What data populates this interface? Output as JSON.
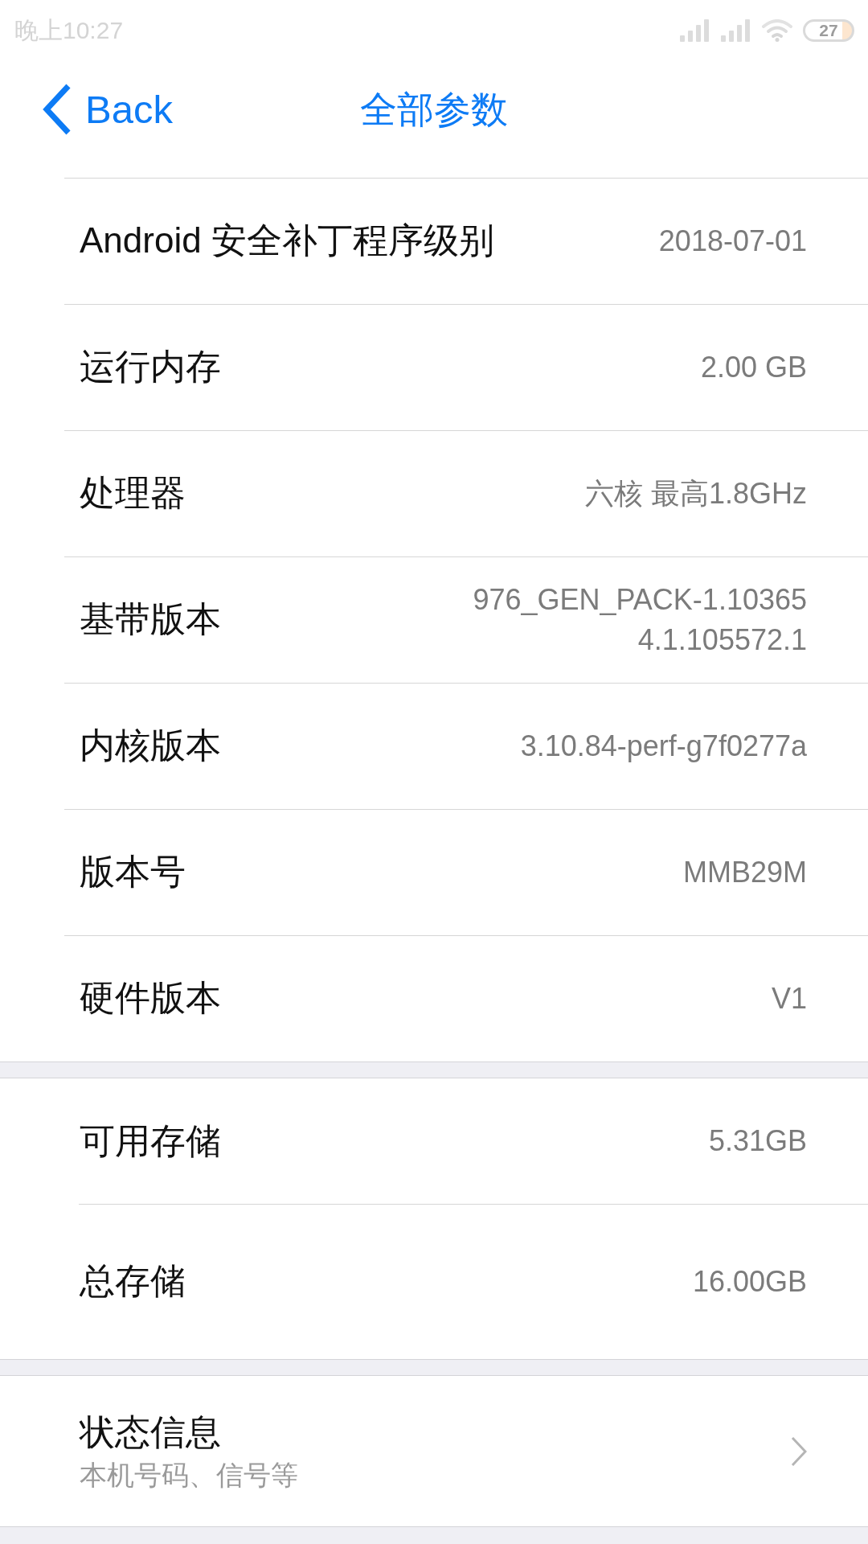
{
  "status_bar": {
    "time": "晚上10:27",
    "battery": "27"
  },
  "nav_bar": {
    "back_label": "Back",
    "title": "全部参数"
  },
  "sections": [
    {
      "rows": [
        {
          "kind": "info",
          "label": "Android 安全补丁程序级别",
          "value_lines": [
            "2018-07-01"
          ]
        },
        {
          "kind": "info",
          "label": "运行内存",
          "value_lines": [
            "2.00 GB"
          ]
        },
        {
          "kind": "info",
          "label": "处理器",
          "value_lines": [
            "六核 最高1.8GHz"
          ]
        },
        {
          "kind": "info",
          "label": "基带版本",
          "value_lines": [
            "976_GEN_PACK-1.10365",
            "4.1.105572.1"
          ]
        },
        {
          "kind": "info",
          "label": "内核版本",
          "value_lines": [
            "3.10.84-perf-g7f0277a"
          ]
        },
        {
          "kind": "info",
          "label": "版本号",
          "value_lines": [
            "MMB29M"
          ]
        },
        {
          "kind": "info",
          "label": "硬件版本",
          "value_lines": [
            "V1"
          ]
        }
      ]
    },
    {
      "rows": [
        {
          "kind": "info",
          "label": "可用存储",
          "value_lines": [
            "5.31GB"
          ]
        },
        {
          "kind": "info",
          "label": "总存储",
          "value_lines": [
            "16.00GB"
          ]
        }
      ]
    },
    {
      "rows": [
        {
          "kind": "link",
          "label": "状态信息",
          "subtitle": "本机号码、信号等"
        }
      ]
    }
  ]
}
